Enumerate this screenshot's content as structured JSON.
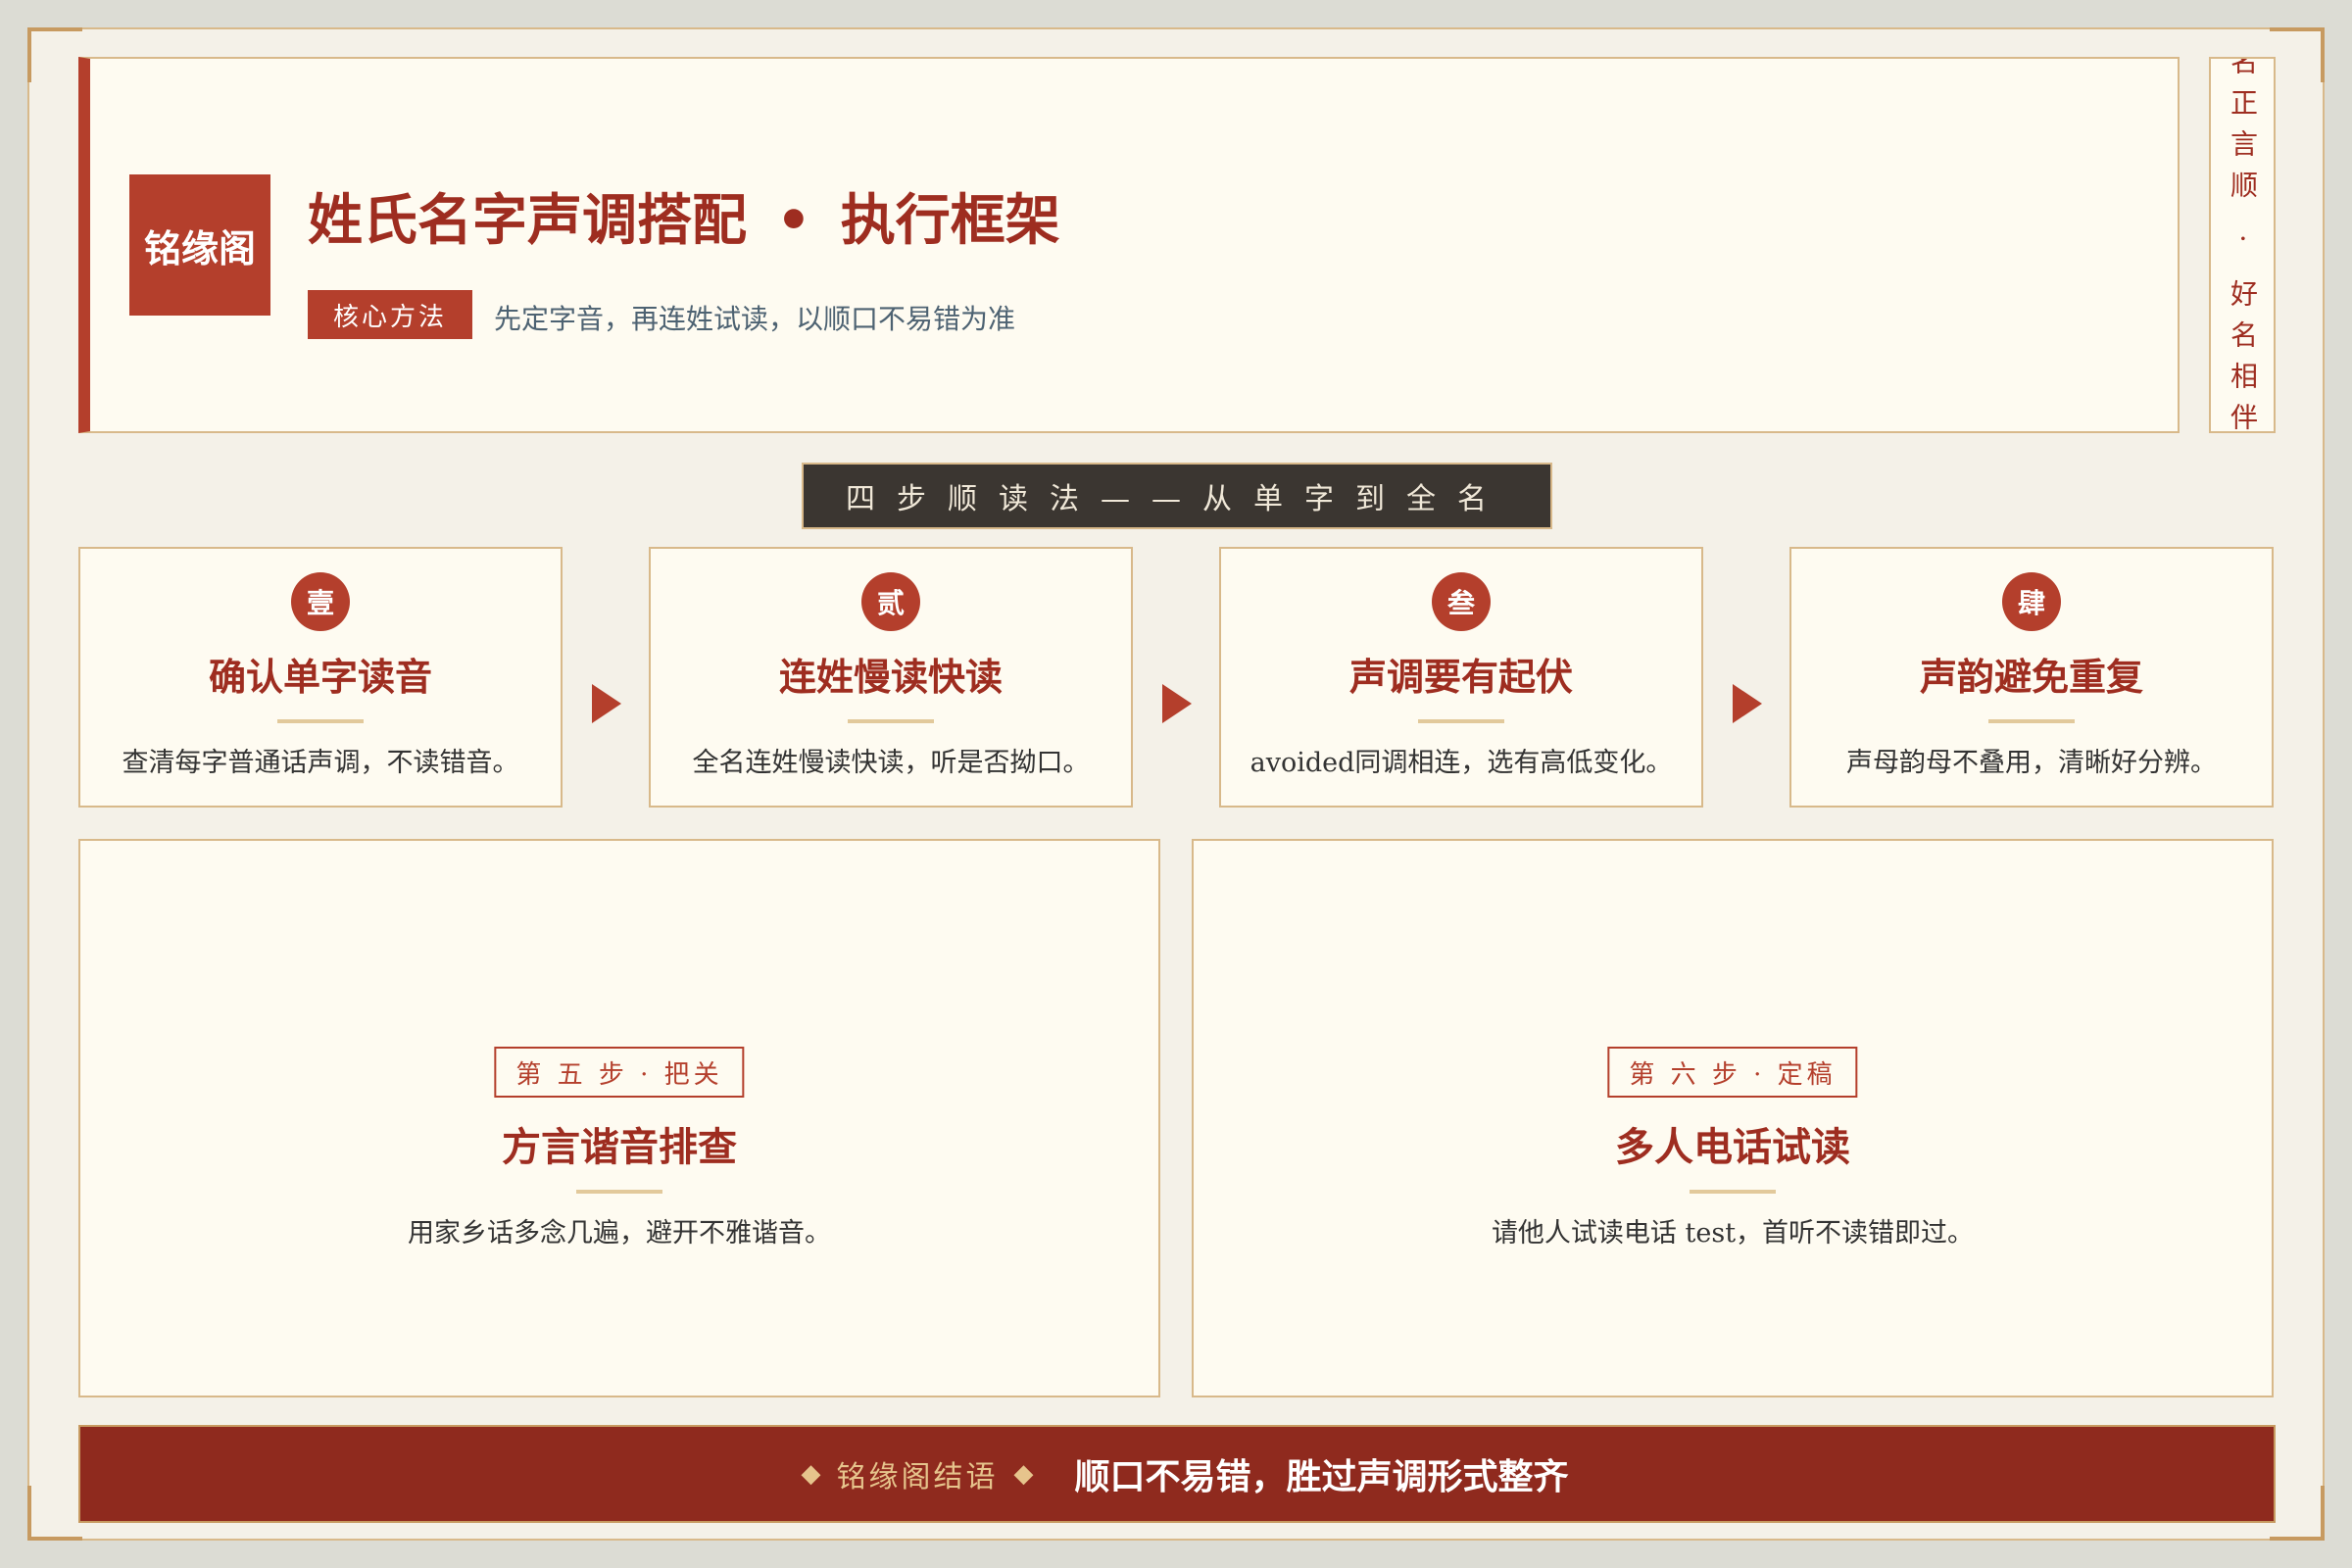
{
  "header": {
    "logo": "铭缘阁",
    "title_left": "姓氏名字声调搭配",
    "title_dot": "•",
    "title_right": "执行框架",
    "method_tag": "核心方法",
    "method_text": "先定字音，再连姓试读，以顺口不易错为准",
    "side_motto": "名正言顺 · 好名相伴"
  },
  "banner": "四步顺读法——从单字到全名",
  "steps": [
    {
      "num": "壹",
      "title": "确认单字读音",
      "desc": "查清每字普通话声调，不读错音。"
    },
    {
      "num": "贰",
      "title": "连姓慢读快读",
      "desc": "全名连姓慢读快读，听是否拗口。"
    },
    {
      "num": "叁",
      "title": "声调要有起伏",
      "desc": "avoided同调相连，选有高低变化。"
    },
    {
      "num": "肆",
      "title": "声韵避免重复",
      "desc": "声母韵母不叠用，清晰好分辨。"
    }
  ],
  "cards": [
    {
      "tag": "第 五 步 · 把关",
      "title": "方言谐音排查",
      "desc": "用家乡话多念几遍，避开不雅谐音。"
    },
    {
      "tag": "第 六 步 · 定稿",
      "title": "多人电话试读",
      "desc": "请他人试读电话 test，首听不读错即过。"
    }
  ],
  "footer": {
    "label": "铭缘阁结语",
    "diamond": "◆",
    "text": "顺口不易错，胜过声调形式整齐"
  },
  "colors": {
    "accent": "#b43f2c",
    "title_red": "#9e2d20",
    "gold_border": "#d8b98a",
    "footer_bg": "#8f2a1e",
    "card_bg": "#fefbf1",
    "page_bg": "#f4f1e8"
  }
}
